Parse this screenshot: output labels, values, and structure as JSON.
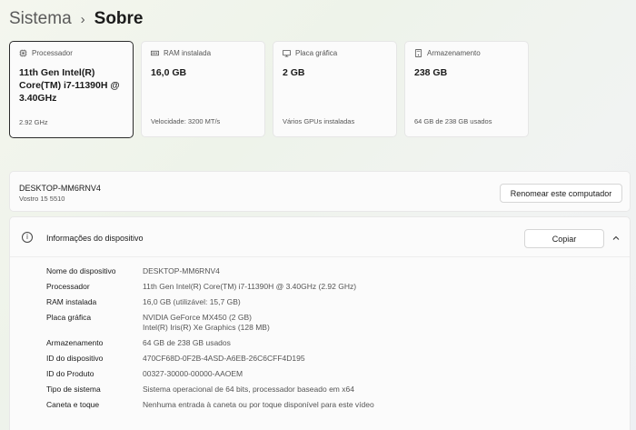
{
  "breadcrumb": {
    "parent": "Sistema",
    "separator": "›",
    "current": "Sobre"
  },
  "cards": [
    {
      "icon": "processor-icon",
      "label": "Processador",
      "value": "11th Gen Intel(R) Core(TM) i7-11390H @ 3.40GHz",
      "sub": "2.92 GHz",
      "selected": true
    },
    {
      "icon": "ram-icon",
      "label": "RAM instalada",
      "value": "16,0 GB",
      "sub": "Velocidade: 3200 MT/s",
      "selected": false
    },
    {
      "icon": "graphics-card-icon",
      "label": "Placa gráfica",
      "value": "2 GB",
      "sub": "Vários GPUs instaladas",
      "selected": false
    },
    {
      "icon": "storage-icon",
      "label": "Armazenamento",
      "value": "238 GB",
      "sub": "64 GB de 238 GB usados",
      "selected": false
    }
  ],
  "device": {
    "name": "DESKTOP-MM6RNV4",
    "model": "Vostro 15 5510",
    "rename_label": "Renomear este computador"
  },
  "info": {
    "title": "Informações do dispositivo",
    "copy_label": "Copiar",
    "rows": [
      {
        "key": "Nome do dispositivo",
        "value": "DESKTOP-MM6RNV4"
      },
      {
        "key": "Processador",
        "value": "11th Gen Intel(R) Core(TM) i7-11390H @ 3.40GHz (2.92 GHz)"
      },
      {
        "key": "RAM instalada",
        "value": "16,0 GB (utilizável: 15,7 GB)"
      },
      {
        "key": "Placa gráfica",
        "value": "NVIDIA GeForce MX450 (2 GB)",
        "value2": "Intel(R) Iris(R) Xe Graphics (128 MB)"
      },
      {
        "key": "Armazenamento",
        "value": "64 GB de 238 GB usados"
      },
      {
        "key": "ID do dispositivo",
        "value": "470CF68D-0F2B-4ASD-A6EB-26C6CFF4D195"
      },
      {
        "key": "ID do Produto",
        "value": "00327-30000-00000-AAOEM"
      },
      {
        "key": "Tipo de sistema",
        "value": "Sistema operacional de 64 bits, processador baseado em x64"
      },
      {
        "key": "Caneta e toque",
        "value": "Nenhuma entrada à caneta ou por toque disponível para este vídeo"
      }
    ]
  }
}
